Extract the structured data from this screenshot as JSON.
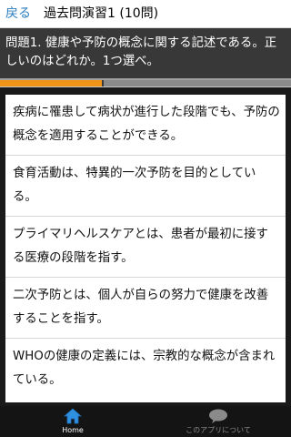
{
  "header": {
    "back_label": "戻る",
    "title": "過去問演習1 (10問)"
  },
  "question": {
    "text": "問題1. 健康や予防の概念に関する記述である。正しいのはどれか。1つ選べ。"
  },
  "progress": {
    "fraction": 0.35
  },
  "answers": [
    {
      "text": "疾病に罹患して病状が進行した段階でも、予防の概念を適用することができる。"
    },
    {
      "text": "食育活動は、特異的一次予防を目的としている。"
    },
    {
      "text": "プライマリヘルスケアとは、患者が最初に接する医療の段階を指す。"
    },
    {
      "text": "二次予防とは、個人が自らの努力で健康を改善することを指す。"
    },
    {
      "text": "WHOの健康の定義には、宗教的な概念が含まれている。"
    }
  ],
  "bottom_nav": {
    "home_label": "Home",
    "home_icon": "home-icon",
    "about_label": "このアプリについて",
    "about_icon": "speech-bubble-icon"
  },
  "colors": {
    "accent": "#2a7ec0",
    "progress": "#f09418",
    "question_bg": "#383838"
  }
}
